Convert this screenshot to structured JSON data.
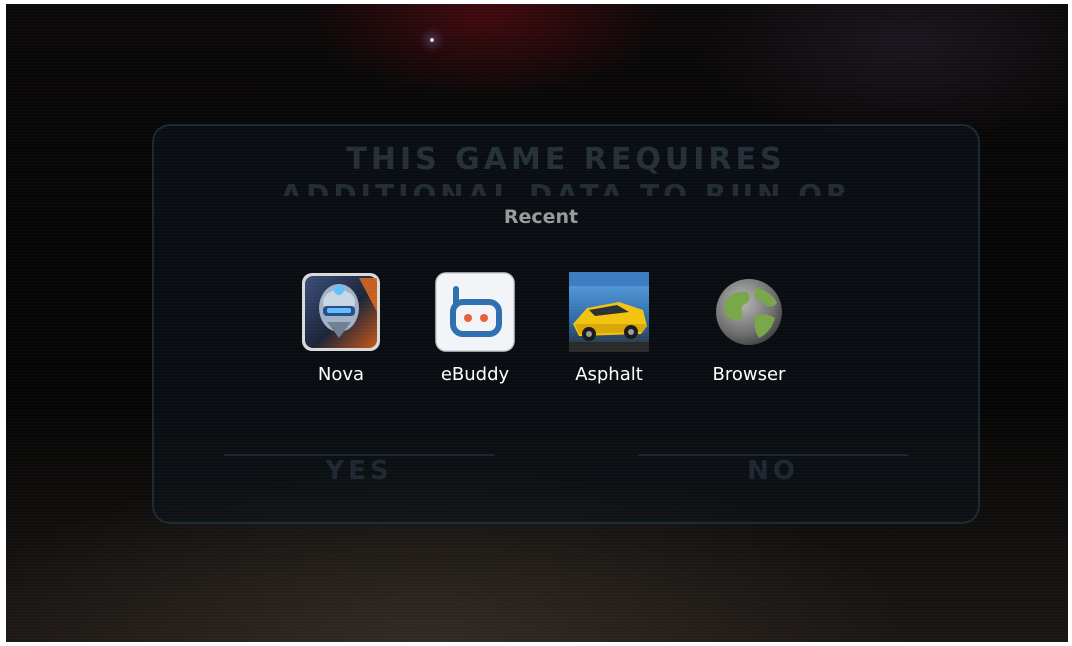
{
  "background_game": {
    "dialog_title": "THIS GAME REQUIRES",
    "dialog_subtitle": "ADDITIONAL DATA TO RUN OR",
    "yes_label": "YES",
    "no_label": "NO"
  },
  "recent": {
    "title": "Recent",
    "apps": [
      {
        "label": "Nova",
        "icon": "nova-game-icon"
      },
      {
        "label": "eBuddy",
        "icon": "ebuddy-icon"
      },
      {
        "label": "Asphalt",
        "icon": "asphalt-game-icon"
      },
      {
        "label": "Browser",
        "icon": "globe-icon"
      }
    ]
  },
  "colors": {
    "recent_title": "#9a9a9a",
    "app_label": "#ffffff",
    "ebuddy_blue": "#2f6fb0",
    "ebuddy_dot": "#e8603a",
    "globe_green": "#7aa64a"
  }
}
